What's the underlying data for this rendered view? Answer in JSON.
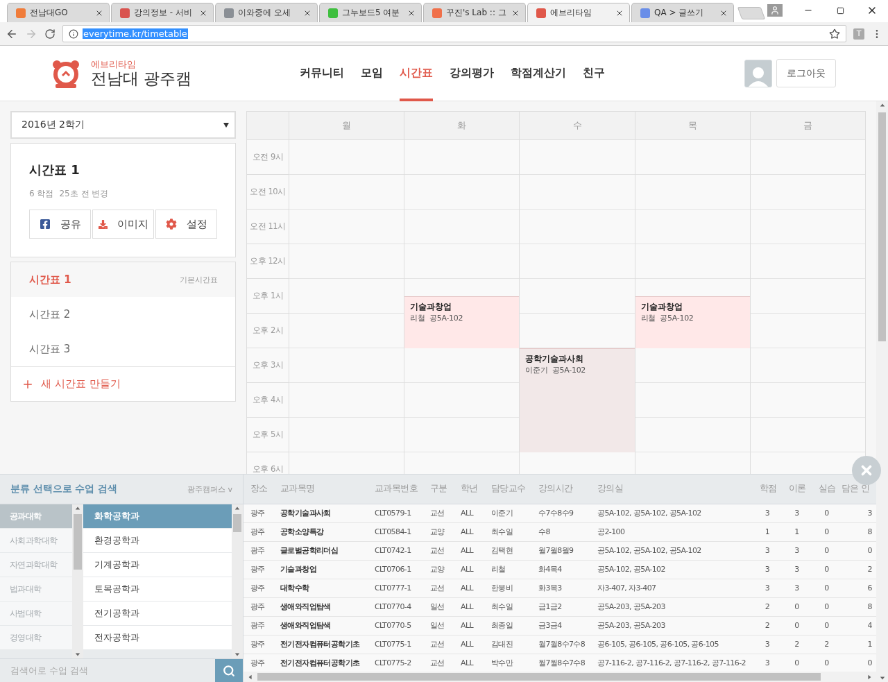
{
  "browser": {
    "tabs": [
      {
        "title": "전남대GO",
        "selected": false,
        "color": "#f07c3a"
      },
      {
        "title": "강의정보 - 서비",
        "selected": false,
        "color": "#d9534f"
      },
      {
        "title": "이와중에 오세",
        "selected": false,
        "color": "#8a8f95"
      },
      {
        "title": "그누보드5 여분",
        "selected": false,
        "color": "#3fbf3f"
      },
      {
        "title": "꾸진's Lab :: 그",
        "selected": false,
        "color": "#f0704a"
      },
      {
        "title": "에브리타임",
        "selected": true,
        "color": "#e0584a"
      },
      {
        "title": "QA > 글쓰기",
        "selected": false,
        "color": "#6a8ee8"
      }
    ],
    "url": "everytime.kr/timetable",
    "extension_label": "T"
  },
  "header": {
    "brand_small": "에브리타임",
    "brand_title": "전남대 광주캠",
    "nav": [
      {
        "label": "커뮤니티",
        "selected": false
      },
      {
        "label": "모임",
        "selected": false
      },
      {
        "label": "시간표",
        "selected": true
      },
      {
        "label": "강의평가",
        "selected": false
      },
      {
        "label": "학점계산기",
        "selected": false
      },
      {
        "label": "친구",
        "selected": false
      }
    ],
    "logout": "로그아웃"
  },
  "semester": "2016년 2학기",
  "timetable_card": {
    "title": "시간표 1",
    "credits": "6 학점",
    "updated": "25초 전 변경",
    "actions": [
      {
        "kind": "share",
        "label": "공유"
      },
      {
        "kind": "download",
        "label": "이미지"
      },
      {
        "kind": "settings",
        "label": "설정"
      }
    ]
  },
  "timetable_list": {
    "items": [
      {
        "label": "시간표 1",
        "selected": true,
        "tag": "기본시간표"
      },
      {
        "label": "시간표 2",
        "selected": false
      },
      {
        "label": "시간표 3",
        "selected": false
      }
    ],
    "new_label": "새 시간표 만들기"
  },
  "grid": {
    "hours": [
      "오전 9시",
      "오전 10시",
      "오전 11시",
      "오후 12시",
      "오후 1시",
      "오후 2시",
      "오후 3시",
      "오후 4시",
      "오후 5시",
      "오후 6시"
    ],
    "days": [
      {
        "label": "월"
      },
      {
        "label": "화",
        "slots": [
          {
            "kind": "free"
          },
          {
            "kind": "free"
          },
          {
            "kind": "free"
          },
          {
            "kind": "free"
          },
          {
            "kind": "free"
          },
          {
            "kind": "free"
          },
          {
            "kind": "free"
          },
          {
            "kind": "free"
          },
          {
            "kind": "free"
          },
          {
            "kind": "class",
            "title": "기술과창업",
            "professor": "리철",
            "room": "공5A-102",
            "color": "#ffe8e8"
          },
          {
            "kind": "continued"
          },
          {
            "kind": "continued"
          }
        ]
      },
      {
        "label": "수",
        "slots": [
          {
            "kind": "free"
          },
          {
            "kind": "free"
          },
          {
            "kind": "free"
          },
          {
            "kind": "free"
          },
          {
            "kind": "free"
          },
          {
            "kind": "free"
          },
          {
            "kind": "free"
          },
          {
            "kind": "free"
          },
          {
            "kind": "free"
          },
          {
            "kind": "free"
          },
          {
            "kind": "free"
          },
          {
            "kind": "free"
          },
          {
            "kind": "class",
            "title": "공학기술과사회",
            "professor": "이준기",
            "room": "공5A-102",
            "color": "#f2e8e8"
          },
          {
            "kind": "continued"
          },
          {
            "kind": "continued"
          },
          {
            "kind": "continued"
          },
          {
            "kind": "continued"
          },
          {
            "kind": "continued"
          }
        ]
      },
      {
        "label": "목",
        "slots": [
          {
            "kind": "free"
          },
          {
            "kind": "free"
          },
          {
            "kind": "free"
          },
          {
            "kind": "free"
          },
          {
            "kind": "free"
          },
          {
            "kind": "free"
          },
          {
            "kind": "free"
          },
          {
            "kind": "free"
          },
          {
            "kind": "free"
          },
          {
            "kind": "class",
            "title": "기술과창업",
            "professor": "리철",
            "room": "공5A-102",
            "color": "#ffe8e8"
          },
          {
            "kind": "continued"
          },
          {
            "kind": "continued"
          }
        ]
      },
      {
        "label": "금"
      }
    ]
  },
  "search": {
    "title": "분류 선택으로 수업 검색",
    "campus": "광주캠퍼스 v",
    "colleges": [
      {
        "label": "공과대학",
        "selected": true
      },
      {
        "label": "사회과학대학",
        "selected": false
      },
      {
        "label": "자연과학대학",
        "selected": false
      },
      {
        "label": "법과대학",
        "selected": false
      },
      {
        "label": "사범대학",
        "selected": false
      },
      {
        "label": "경영대학",
        "selected": false
      }
    ],
    "departments": [
      {
        "label": "화학공학과",
        "selected": true
      },
      {
        "label": "환경공학과",
        "selected": false
      },
      {
        "label": "기계공학과",
        "selected": false
      },
      {
        "label": "토목공학과",
        "selected": false
      },
      {
        "label": "전기공학과",
        "selected": false
      },
      {
        "label": "전자공학과",
        "selected": false
      }
    ],
    "placeholder": "검색어로 수업 검색"
  },
  "courses": {
    "columns": [
      {
        "label": "장소",
        "kind": "text"
      },
      {
        "label": "교과목명",
        "kind": "title"
      },
      {
        "label": "교과목번호",
        "kind": "text"
      },
      {
        "label": "구분",
        "kind": "text"
      },
      {
        "label": "학년",
        "kind": "text"
      },
      {
        "label": "담당교수",
        "kind": "text"
      },
      {
        "label": "강의시간",
        "kind": "text"
      },
      {
        "label": "강의실",
        "kind": "text"
      },
      {
        "label": "학점",
        "kind": "number"
      },
      {
        "label": "이론",
        "kind": "number"
      },
      {
        "label": "실습",
        "kind": "number"
      },
      {
        "label": "담은 인",
        "kind": "end"
      }
    ],
    "rows": [
      [
        "광주",
        "공학기술과사회",
        "CLT0579-1",
        "교선",
        "ALL",
        "이준기",
        "수7수8수9",
        "공5A-102, 공5A-102, 공5A-102",
        "3",
        "3",
        "0",
        "3"
      ],
      [
        "광주",
        "공학소양특강",
        "CLT0584-1",
        "교양",
        "ALL",
        "최수일",
        "수8",
        "공2-100",
        "1",
        "1",
        "0",
        "8"
      ],
      [
        "광주",
        "글로벌공학리더십",
        "CLT0742-1",
        "교선",
        "ALL",
        "김택현",
        "월7월8월9",
        "공5A-102, 공5A-102, 공5A-102",
        "3",
        "3",
        "0",
        "0"
      ],
      [
        "광주",
        "기술과창업",
        "CLT0706-1",
        "교양",
        "ALL",
        "리철",
        "화4목4",
        "공5A-102, 공5A-102",
        "3",
        "3",
        "0",
        "2"
      ],
      [
        "광주",
        "대학수학",
        "CLT0777-1",
        "교선",
        "ALL",
        "한붕비",
        "화3목3",
        "자3-407, 자3-407",
        "3",
        "3",
        "0",
        "6"
      ],
      [
        "광주",
        "생애와직업탐색",
        "CLT0770-4",
        "일선",
        "ALL",
        "최수일",
        "금1금2",
        "공5A-203, 공5A-203",
        "2",
        "0",
        "0",
        "8"
      ],
      [
        "광주",
        "생애와직업탐색",
        "CLT0770-5",
        "일선",
        "ALL",
        "최종일",
        "금3금4",
        "공5A-203, 공5A-203",
        "2",
        "0",
        "0",
        "4"
      ],
      [
        "광주",
        "전기전자컴퓨터공학기초",
        "CLT0775-1",
        "교선",
        "ALL",
        "김대진",
        "월7월8수7수8",
        "공6-105, 공6-105, 공6-105, 공6-105",
        "3",
        "2",
        "2",
        "1"
      ],
      [
        "광주",
        "전기전자컴퓨터공학기초",
        "CLT0775-2",
        "교선",
        "ALL",
        "박수만",
        "월7월8수7수8",
        "공7-116-2, 공7-116-2, 공7-116-2, 공7-116-2",
        "3",
        "0",
        "0",
        "0"
      ]
    ]
  }
}
